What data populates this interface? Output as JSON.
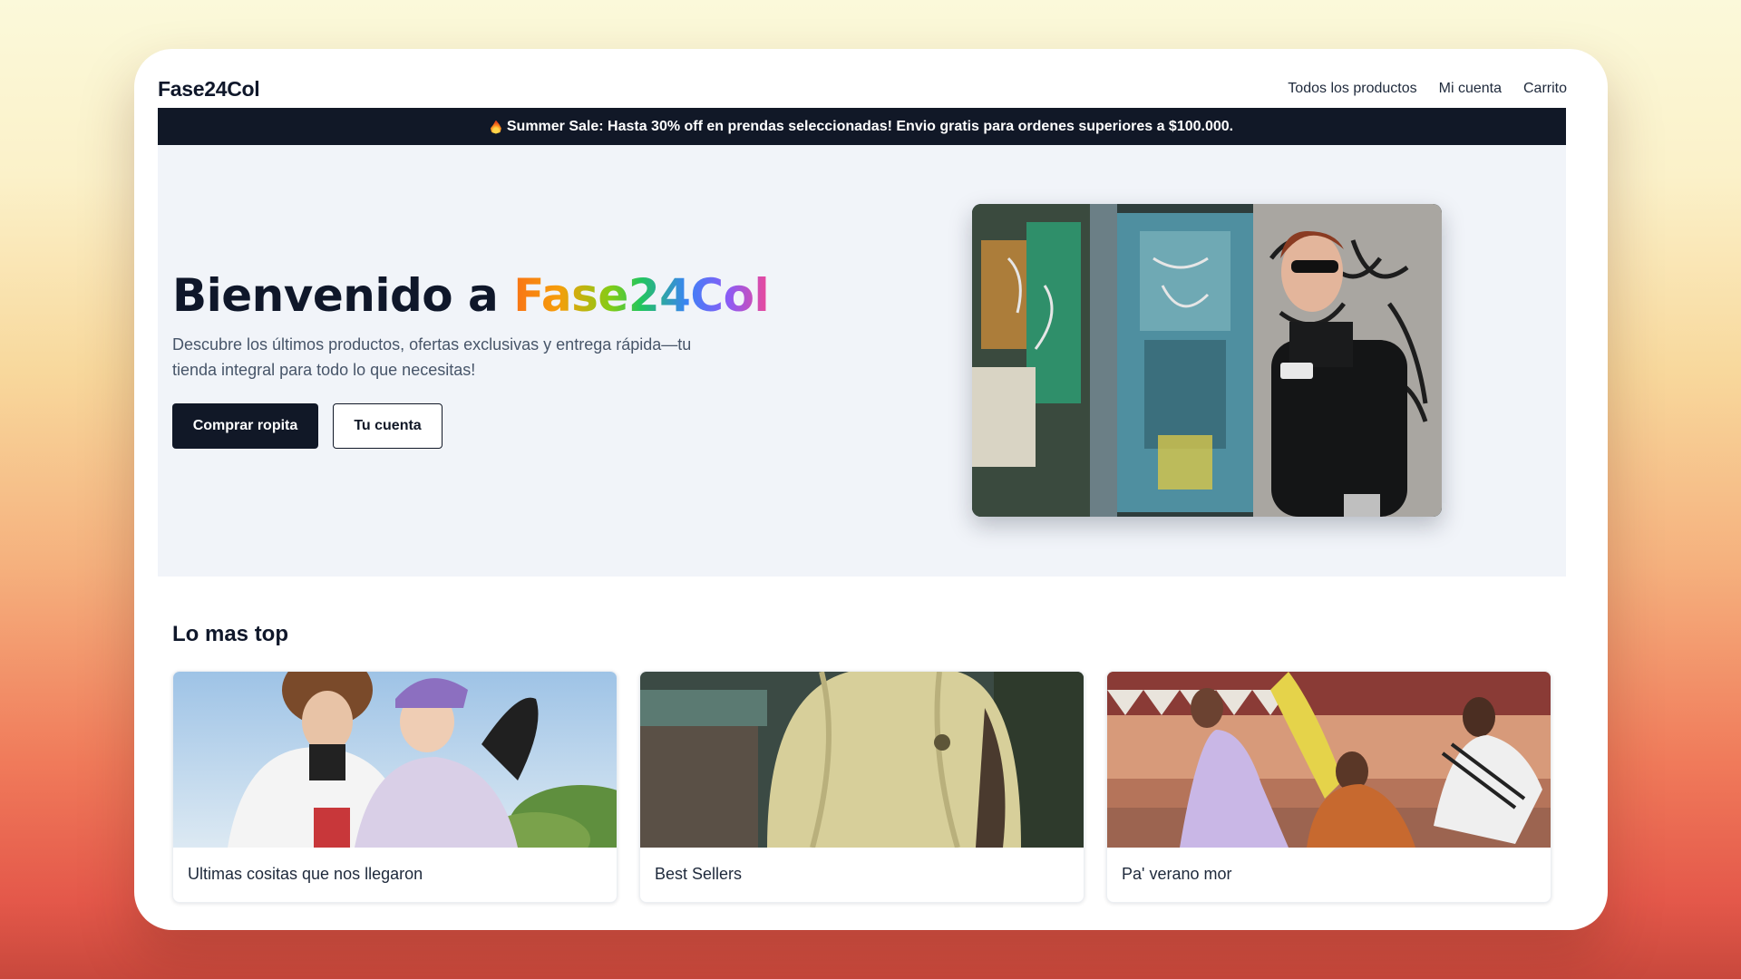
{
  "header": {
    "brand": "Fase24Col",
    "nav": [
      "Todos los productos",
      "Mi cuenta",
      "Carrito"
    ]
  },
  "banner": {
    "icon": "fire-icon",
    "text": "Summer Sale: Hasta 30% off en prendas seleccionadas! Envio gratis para ordenes superiores a $100.000."
  },
  "hero": {
    "title_prefix": "Bienvenido a ",
    "title_brand": "Fase24Col",
    "description": "Descubre los últimos productos, ofertas exclusivas y entrega rápida—tu tienda integral para todo lo que necesitas!",
    "primary_button": "Comprar ropita",
    "secondary_button": "Tu cuenta"
  },
  "section": {
    "title": "Lo mas top",
    "cards": [
      {
        "label": "Ultimas cositas que nos llegaron"
      },
      {
        "label": "Best Sellers"
      },
      {
        "label": "Pa' verano mor"
      }
    ]
  },
  "colors": {
    "primary": "#111827",
    "hero_bg": "#f1f4f9",
    "text_muted": "#475569"
  }
}
